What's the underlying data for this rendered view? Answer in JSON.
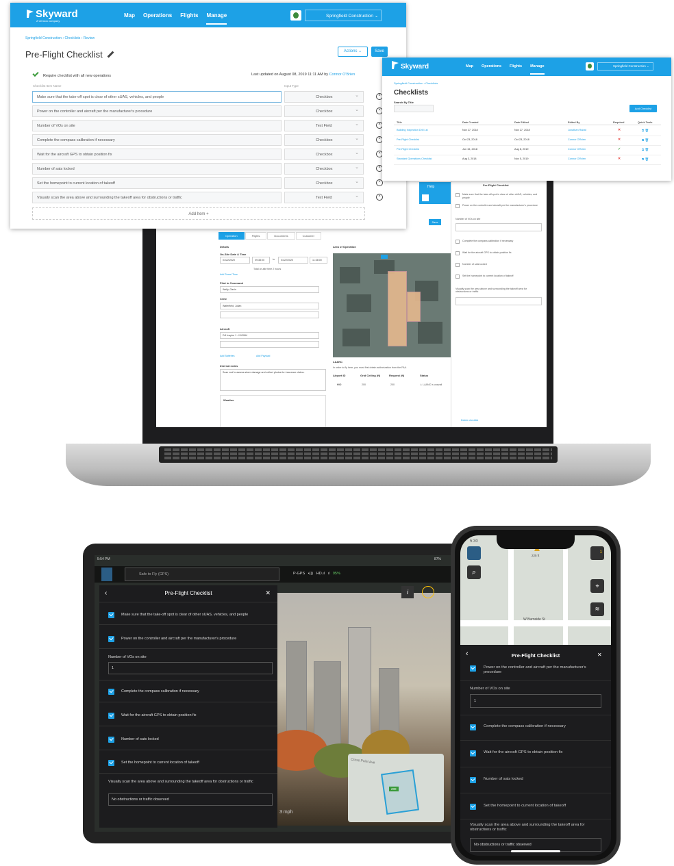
{
  "nav": {
    "brand": "Skyward",
    "brand_sub": "A Verizon company",
    "links": [
      "Map",
      "Operations",
      "Flights",
      "Manage"
    ],
    "org": "Springfield Construction"
  },
  "preflight": {
    "breadcrumb": "Springfield Construction  ›  Checklists  ›  Review",
    "title": "Pre-Flight Checklist",
    "actions_label": "Actions",
    "save_label": "Save",
    "require_label": "Require checklist with all new operations",
    "updated_text": "Last updated on August 08, 2019 11:11 AM by",
    "updated_by": "Connor O'Brien",
    "col_item": "Checklist Item Name",
    "col_type": "Input Type",
    "items": [
      {
        "name": "Make sure that the take-off spot is clear of other sUAS, vehicles, and people",
        "type": "Checkbox"
      },
      {
        "name": "Power on the controller and aircraft per the manufacturer's procedure",
        "type": "Checkbox"
      },
      {
        "name": "Number of VOs on site",
        "type": "Text Field"
      },
      {
        "name": "Complete the compass calibration if necessary",
        "type": "Checkbox"
      },
      {
        "name": "Wait for the aircraft GPS to obtain position fix",
        "type": "Checkbox"
      },
      {
        "name": "Number of sats locked",
        "type": "Checkbox"
      },
      {
        "name": "Set the homepoint to current location of takeoff",
        "type": "Checkbox"
      },
      {
        "name": "Visually scan the area above and surrounding the takeoff area for obstructions or traffic",
        "type": "Text Field"
      }
    ],
    "add_item": "Add Item +"
  },
  "checklists": {
    "breadcrumb": "Springfield Construction  ›  Checklists",
    "title": "Checklists",
    "search_label": "Search By Title",
    "add_button": "Add Checklist",
    "headers": [
      "Title",
      "Date Created",
      "Date Edited",
      "Edited By",
      "Required",
      "Quick Tools"
    ],
    "rows": [
      {
        "title": "Building Inspection Drill Lst",
        "created": "Nov 27, 2018",
        "edited": "Nov 27, 2018",
        "by": "Jonathan Rabat",
        "required": "✕"
      },
      {
        "title": "Pre-Flight Checklist",
        "created": "Oct 23, 2018",
        "edited": "Oct 23, 2018",
        "by": "Connor O'Brien",
        "required": "✕"
      },
      {
        "title": "Pre-Flight Checklist",
        "created": "Jun 15, 2018",
        "edited": "Aug 8, 2019",
        "by": "Connor O'Brien",
        "required": "✓"
      },
      {
        "title": "Standard Operations Checklist",
        "created": "Aug 3, 2018",
        "edited": "Nov 5, 2019",
        "by": "Connor O'Brien",
        "required": "✕"
      }
    ]
  },
  "laptop": {
    "tabs": [
      "Operation",
      "Flights",
      "Documents",
      "Customer"
    ],
    "details": "Details",
    "dates_label": "On-Site Date & Time",
    "date1": "01/22/2020",
    "time1": "09:38:00",
    "to": "to",
    "date2": "01/22/2020",
    "time2": "11:38:00",
    "total": "Total on-site time 2 hours",
    "add_travel": "Add Travel Time",
    "pic_label": "Pilot in Command",
    "pic": "Welly, Gavin",
    "crew_label": "Crew",
    "crew": "Waterfield, Julian",
    "aircraft_label": "Aircraft",
    "aircraft": "DJI Inspire 1 - N12064",
    "add_batteries": "Add Batteries",
    "add_payload": "Add Payload",
    "notes_label": "Internal notes",
    "notes": "Scan roof to assess storm damage and collect photos for insurance claims.",
    "weather": "Weather",
    "aoo": "Area of Operation",
    "laanc": "LAANC",
    "laanc_text": "In order to fly here, you must first obtain authorization from the FAA.",
    "laanc_cols": [
      "Airport ID",
      "Grid Ceiling (ft)",
      "Request (ft)",
      "Status"
    ],
    "laanc_row": [
      "HIO",
      "200",
      "200",
      "⚠ LAANC is unavail"
    ],
    "help": "Help",
    "side_title": "Pre-Flight Checklist",
    "side_items": [
      "Make sure that the take-off spot is clear of other sUAS, vehicles, and people",
      "Power on the controller and aircraft per the manufacturer's procedure",
      "Number of VOs on site",
      "Complete the compass calibration if necessary",
      "Wait for the aircraft GPS to obtain position fix",
      "Number of sats locked",
      "Set the homepoint to current location of takeoff",
      "Visually scan the area above and surrounding the takeoff area for obstructions or traffic"
    ],
    "delete": "Delete checklist",
    "save": "Save"
  },
  "tablet": {
    "time": "5:54 PM",
    "battery": "87%",
    "safe": "Safe to Fly (GPS)",
    "gps": "P-GPS",
    "hd": "HD",
    "pct": "95%",
    "speed": "3 mph",
    "map_label": "Cross Point Ave",
    "map_badge": "200",
    "panel_title": "Pre-Flight Checklist",
    "checks": [
      "Make sure that the take-off spot is clear of other sUAS, vehicles, and people",
      "Power on the controller and aircraft per the manufacturer's procedure"
    ],
    "vo_label": "Number of VOs on site",
    "vo_value": "1",
    "checks2": [
      "Complete the compass calibration if necessary",
      "Wait for the aircraft GPS to obtain position fix",
      "Number of sats locked",
      "Set the homepoint to current location of takeoff"
    ],
    "scan_label": "Visually scan the area above and surrounding the takeoff area for obstructions or traffic",
    "scan_value": "No obstructions or traffic observed"
  },
  "phone": {
    "time": "5:30",
    "map_street": "W Burnside St",
    "map_alt": "225 ft",
    "badge": "1",
    "title": "Pre-Flight Checklist",
    "check1": "Power on the controller and aircraft per the manufacturer's procedure",
    "vo_label": "Number of VOs on site",
    "vo_value": "1",
    "checks": [
      "Complete the compass calibration if necessary",
      "Wait for the aircraft GPS to obtain position fix",
      "Number of sats locked",
      "Set the homepoint to current location of takeoff"
    ],
    "scan_label": "Visually scan the area above and surrounding the takeoff area for obstructions or traffic",
    "scan_value": "No obstructions or traffic observed"
  }
}
